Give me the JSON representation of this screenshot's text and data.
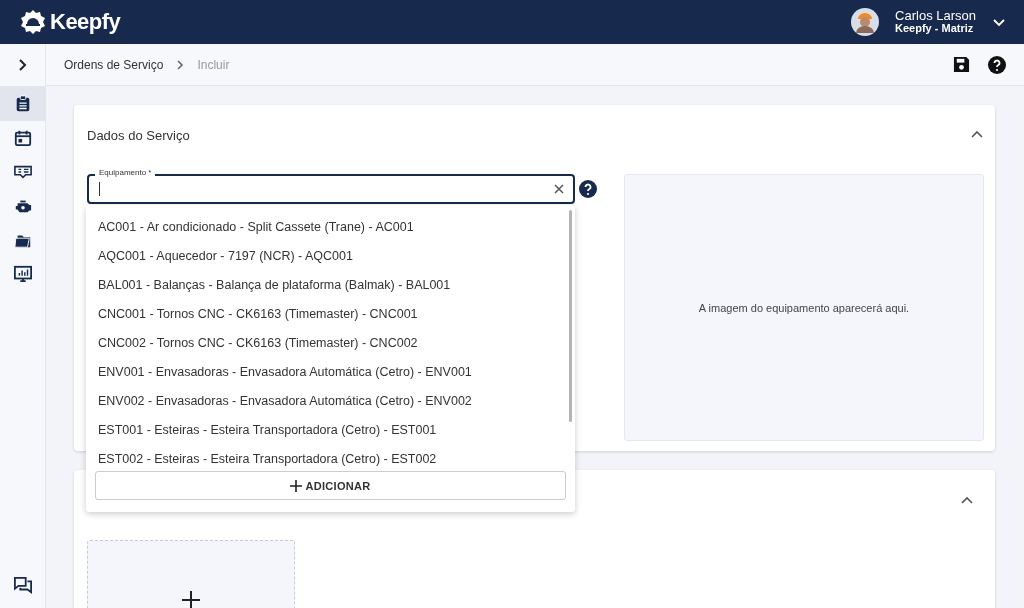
{
  "header": {
    "logo": "Keepfy",
    "user": {
      "name": "Carlos Larson",
      "company": "Keepfy - Matriz"
    }
  },
  "sidebar": {
    "items": [
      {
        "kind": "clipboard",
        "selected": true
      },
      {
        "kind": "calendar",
        "selected": false
      },
      {
        "kind": "ticket",
        "selected": false
      },
      {
        "kind": "engine",
        "selected": false
      },
      {
        "kind": "folder",
        "selected": false
      },
      {
        "kind": "monitor",
        "selected": false
      }
    ]
  },
  "breadcrumb": [
    "Ordens de Serviço",
    "Incluir"
  ],
  "service_card": {
    "title": "Dados do Serviço",
    "expanded": true,
    "equipment_field": {
      "label": "Equipamento *"
    },
    "image_placeholder": "A imagem do equipamento aparecerá aqui."
  },
  "dropdown": {
    "options": [
      "AC001 - Ar condicionado - Split Cassete (Trane) - AC001",
      "AQC001 - Aquecedor - 7197 (NCR) - AQC001",
      "BAL001 - Balanças - Balança de plataforma (Balmak) - BAL001",
      "CNC001 - Tornos CNC - CK6163 (Timemaster) - CNC001",
      "CNC002 - Tornos CNC - CK6163 (Timemaster) - CNC002",
      "ENV001 - Envasadoras - Envasadora Automática (Cetro) - ENV001",
      "ENV002 - Envasadoras - Envasadora Automática (Cetro) - ENV002",
      "EST001 - Esteiras - Esteira Transportadora (Cetro) - EST001",
      "EST002 - Esteiras - Esteira Transportadora (Cetro) - EST002"
    ],
    "add_button": "ADICIONAR"
  },
  "second_card": {
    "expanded": true
  }
}
